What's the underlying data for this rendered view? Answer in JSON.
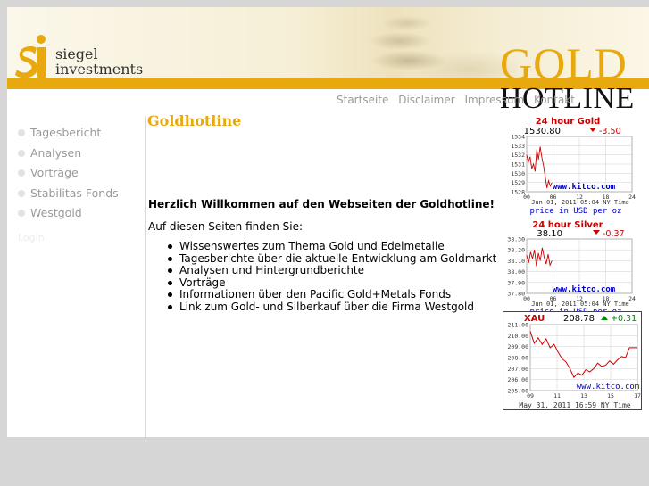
{
  "brand": {
    "name_line1": "siegel",
    "name_line2": "investments",
    "banner_word1": "GOLD",
    "banner_word2": "HOTLINE"
  },
  "topnav": [
    "Startseite",
    "Disclaimer",
    "Impressum",
    "Kontakt"
  ],
  "sidebar": {
    "items": [
      "Tagesbericht",
      "Analysen",
      "Vorträge",
      "Stabilitas Fonds",
      "Westgold"
    ],
    "login": "Login"
  },
  "main": {
    "title": "Goldhotline",
    "welcome": "Herzlich Willkommen auf den Webseiten der Goldhotline!",
    "intro": "Auf diesen Seiten finden Sie:",
    "features": [
      "Wissenswertes zum Thema Gold und Edelmetalle",
      "Tagesberichte über die aktuelle Entwicklung am Goldmarkt",
      "Analysen und Hintergrundberichte",
      "Vorträge",
      "Informationen über den Pacific Gold+Metals Fonds",
      "Link zum Gold- und Silberkauf  über die Firma Westgold"
    ]
  },
  "colors": {
    "gold": "#e8a90f",
    "chart_red": "#cc0000",
    "chart_green": "#008800",
    "chart_blue": "#0000cc"
  },
  "widgets": {
    "gold": {
      "title": "24 hour Gold",
      "price": "1530.80",
      "change": "-3.50",
      "direction": "down",
      "y_ticks": [
        "1534",
        "1533",
        "1532",
        "1531",
        "1530",
        "1529",
        "1528"
      ],
      "x_ticks": [
        "00",
        "06",
        "12",
        "18",
        "24"
      ],
      "watermark": "www.kitco.com",
      "timestamp": "Jun 01, 2011 05:04 NY Time",
      "footer": "price in USD per oz",
      "series": [
        1532.0,
        1531.2,
        1531.8,
        1530.5,
        1531.0,
        1530.2,
        1532.6,
        1531.5,
        1532.9,
        1531.7,
        1530.8,
        1529.6,
        1528.4,
        1529.2,
        1528.6,
        1529.0
      ]
    },
    "silver": {
      "title": "24 hour Silver",
      "price": "38.10",
      "change": "-0.37",
      "direction": "down",
      "y_ticks": [
        "38.30",
        "38.20",
        "38.10",
        "38.00",
        "37.90",
        "37.80"
      ],
      "x_ticks": [
        "00",
        "06",
        "12",
        "18",
        "24"
      ],
      "watermark": "www.kitco.com",
      "timestamp": "Jun 01, 2011 05:04 NY Time",
      "footer": "price in USD per oz",
      "series": [
        38.15,
        38.08,
        38.18,
        38.12,
        38.2,
        38.05,
        38.17,
        38.1,
        38.22,
        38.13,
        38.07,
        38.16,
        38.06,
        38.1
      ]
    },
    "xau": {
      "title": "XAU",
      "price": "208.78",
      "change": "+0.31",
      "direction": "up",
      "y_ticks": [
        "211.00",
        "210.00",
        "209.00",
        "208.00",
        "207.00",
        "206.00",
        "205.00"
      ],
      "x_ticks": [
        "09",
        "11",
        "13",
        "15",
        "17"
      ],
      "watermark": "www.kitco.com",
      "timestamp": "May 31, 2011 16:59 NY Time",
      "series": [
        210.4,
        209.3,
        209.8,
        209.2,
        209.7,
        208.9,
        209.2,
        208.5,
        207.9,
        207.6,
        207.0,
        206.2,
        206.6,
        206.4,
        206.9,
        206.7,
        207.0,
        207.5,
        207.2,
        207.3,
        207.7,
        207.4,
        207.8,
        208.1,
        208.0,
        208.9,
        208.9,
        208.9
      ]
    }
  }
}
